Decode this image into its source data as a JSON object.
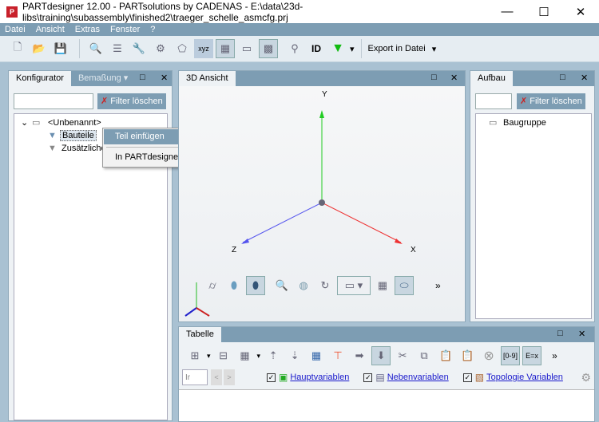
{
  "window": {
    "title": "PARTdesigner 12.00 - PARTsolutions by CADENAS - E:\\data\\23d-libs\\training\\subassembly\\finished2\\traeger_schelle_asmcfg.prj",
    "minimize": "—",
    "maximize": "☐",
    "close": "✕"
  },
  "menu": [
    "Datei",
    "Ansicht",
    "Extras",
    "Fenster",
    "?"
  ],
  "toolbar": {
    "export_label": "Export in Datei",
    "dropdown": "▾"
  },
  "left_panel": {
    "tabs": [
      "Konfigurator",
      "Bemaßung ▾"
    ],
    "filter_value": "",
    "filter_button": "Filter löschen",
    "tree": {
      "root": "<Unbenannt>",
      "children": [
        "Bauteile",
        "Zusätzliche"
      ]
    }
  },
  "context_menu": {
    "items": [
      "Teil einfügen",
      "In PARTdesigner bearbeiten..."
    ]
  },
  "view3d": {
    "tab": "3D Ansicht",
    "axes": {
      "y": "Y",
      "x": "X",
      "z": "Z"
    },
    "more": "»"
  },
  "right_panel": {
    "tab": "Aufbau",
    "filter_button": "Filter löschen",
    "tree_root": "Baugruppe"
  },
  "table_panel": {
    "tab": "Tabelle",
    "more": "»",
    "search_value": "Ir",
    "prev": "<",
    "next": ">",
    "links": [
      "Hauptvariablen",
      "Nebenvariablen",
      "Topologie Variablen"
    ],
    "range_btn": "[0-9]",
    "formula_btn": "E=x"
  },
  "panel_controls": {
    "maximize": "□",
    "close": "✕"
  }
}
